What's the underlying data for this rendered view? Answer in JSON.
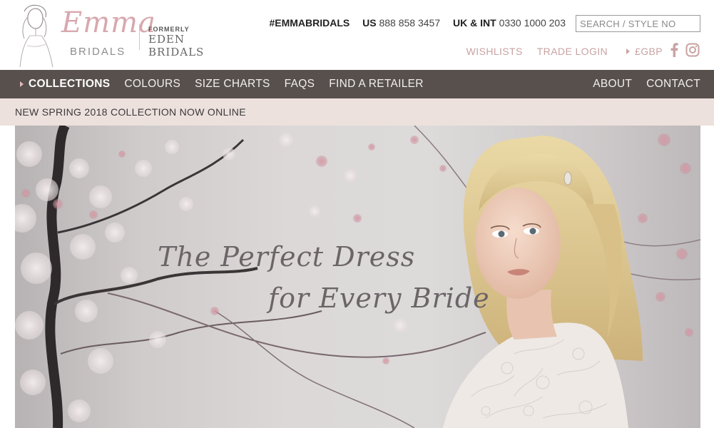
{
  "brand": {
    "logo_text": "Emma",
    "logo_subtext": "BRIDALS",
    "formerly": "FORMERLY",
    "former_name": "EDEN BRIDALS"
  },
  "contact": {
    "hashtag": "#EMMABRIDALS",
    "us_label": "US",
    "us_phone": "888 858 3457",
    "uk_label": "UK & INT",
    "uk_phone": "0330 1000 203"
  },
  "search": {
    "placeholder": "SEARCH / STYLE NO"
  },
  "sub_links": {
    "wishlists": "WISHLISTS",
    "trade_login": "TRADE LOGIN",
    "currency": "£GBP"
  },
  "nav": {
    "left": [
      {
        "label": "COLLECTIONS",
        "active": true
      },
      {
        "label": "COLOURS"
      },
      {
        "label": "SIZE CHARTS"
      },
      {
        "label": "FAQS"
      },
      {
        "label": "FIND A RETAILER"
      }
    ],
    "right": [
      {
        "label": "ABOUT"
      },
      {
        "label": "CONTACT"
      }
    ]
  },
  "announcement": "NEW SPRING 2018 COLLECTION NOW ONLINE",
  "hero": {
    "line1": "The Perfect Dress",
    "line2": "for Every Bride"
  },
  "icons": {
    "facebook": "facebook-icon",
    "instagram": "instagram-icon",
    "currency_caret": "caret-right-icon"
  },
  "colors": {
    "nav_bg": "#57504d",
    "announce_bg": "#ede1dd",
    "accent_pink": "#c9a2a2",
    "logo_pink": "#d8a8ae"
  }
}
